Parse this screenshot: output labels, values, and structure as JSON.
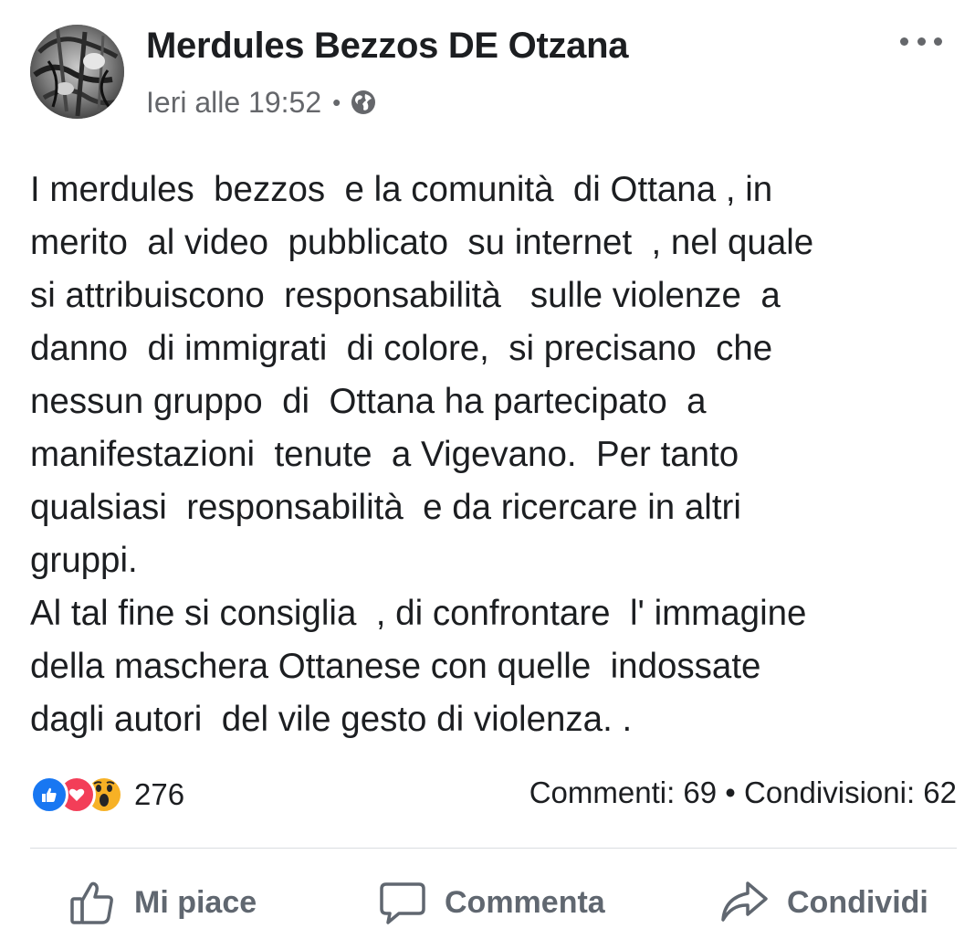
{
  "post": {
    "author": "Merdules Bezzos DE Otzana",
    "timestamp": "Ieri alle 19:52",
    "separator": "•",
    "privacy_icon": "globe-icon",
    "avatar_icon": "page-avatar",
    "more_icon": "more-options-icon",
    "text_lines": [
      "I merdules  bezzos  e la comunità  di Ottana , in",
      "merito  al video  pubblicato  su internet  , nel quale",
      "si attribuiscono  responsabilità   sulle violenze  a",
      "danno  di immigrati  di colore,  si precisano  che",
      "nessun gruppo  di  Ottana ha partecipato  a",
      "manifestazioni  tenute  a Vigevano.  Per tanto",
      "qualsiasi  responsabilità  e da ricercare in altri",
      "gruppi.",
      "Al tal fine si consiglia  , di confrontare  l' immagine",
      "della maschera Ottanese con quelle  indossate",
      "dagli autori  del vile gesto di violenza. ."
    ]
  },
  "engagement": {
    "reaction_icons": [
      "like-reaction",
      "love-reaction",
      "wow-reaction"
    ],
    "reaction_count": "276",
    "stats": "Commenti: 69 • Condivisioni: 62"
  },
  "actions": {
    "like": "Mi piace",
    "comment": "Commenta",
    "share": "Condividi"
  },
  "colors": {
    "like_blue": "#1877f2",
    "love_red": "#f33e58",
    "wow_yellow": "#f7b125",
    "meta_gray": "#65676b",
    "action_gray": "#606770"
  }
}
